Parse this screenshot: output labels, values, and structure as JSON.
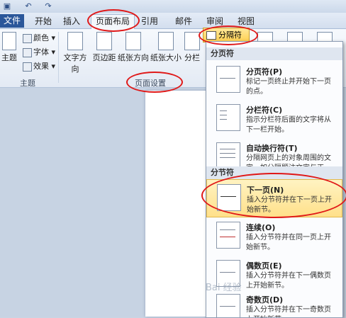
{
  "tabs": [
    {
      "label": "文件"
    },
    {
      "label": "开始"
    },
    {
      "label": "插入"
    },
    {
      "label": "页面布局"
    },
    {
      "label": "引用"
    },
    {
      "label": "邮件"
    },
    {
      "label": "审阅"
    },
    {
      "label": "视图"
    }
  ],
  "ribbon": {
    "theme_group": {
      "theme_label": "主题",
      "colors_label": "颜色",
      "fonts_label": "字体",
      "effects_label": "效果",
      "group_label": "主题"
    },
    "page_setup_group": {
      "text_direction": "文字方向",
      "margins": "页边距",
      "orientation": "纸张方向",
      "size": "纸张大小",
      "columns": "分栏",
      "group_label": "页面设置"
    },
    "breaks_button": "分隔符"
  },
  "dropdown": {
    "page_breaks_header": "分页符",
    "section_breaks_header": "分节符",
    "items": [
      {
        "title": "分页符(P)",
        "desc": "标记一页终止并开始下一页的点。"
      },
      {
        "title": "分栏符(C)",
        "desc": "指示分栏符后面的文字将从下一栏开始。"
      },
      {
        "title": "自动换行符(T)",
        "desc": "分隔网页上的对象周围的文字，如分隔题注文字与正文。"
      },
      {
        "title": "下一页(N)",
        "desc": "插入分节符并在下一页上开始新节。"
      },
      {
        "title": "连续(O)",
        "desc": "插入分节符并在同一页上开始新节。"
      },
      {
        "title": "偶数页(E)",
        "desc": "插入分节符并在下一偶数页上开始新节。"
      },
      {
        "title": "奇数页(D)",
        "desc": "插入分节符并在下一奇数页上开始新节。"
      }
    ]
  },
  "watermark": "Bai 经验"
}
